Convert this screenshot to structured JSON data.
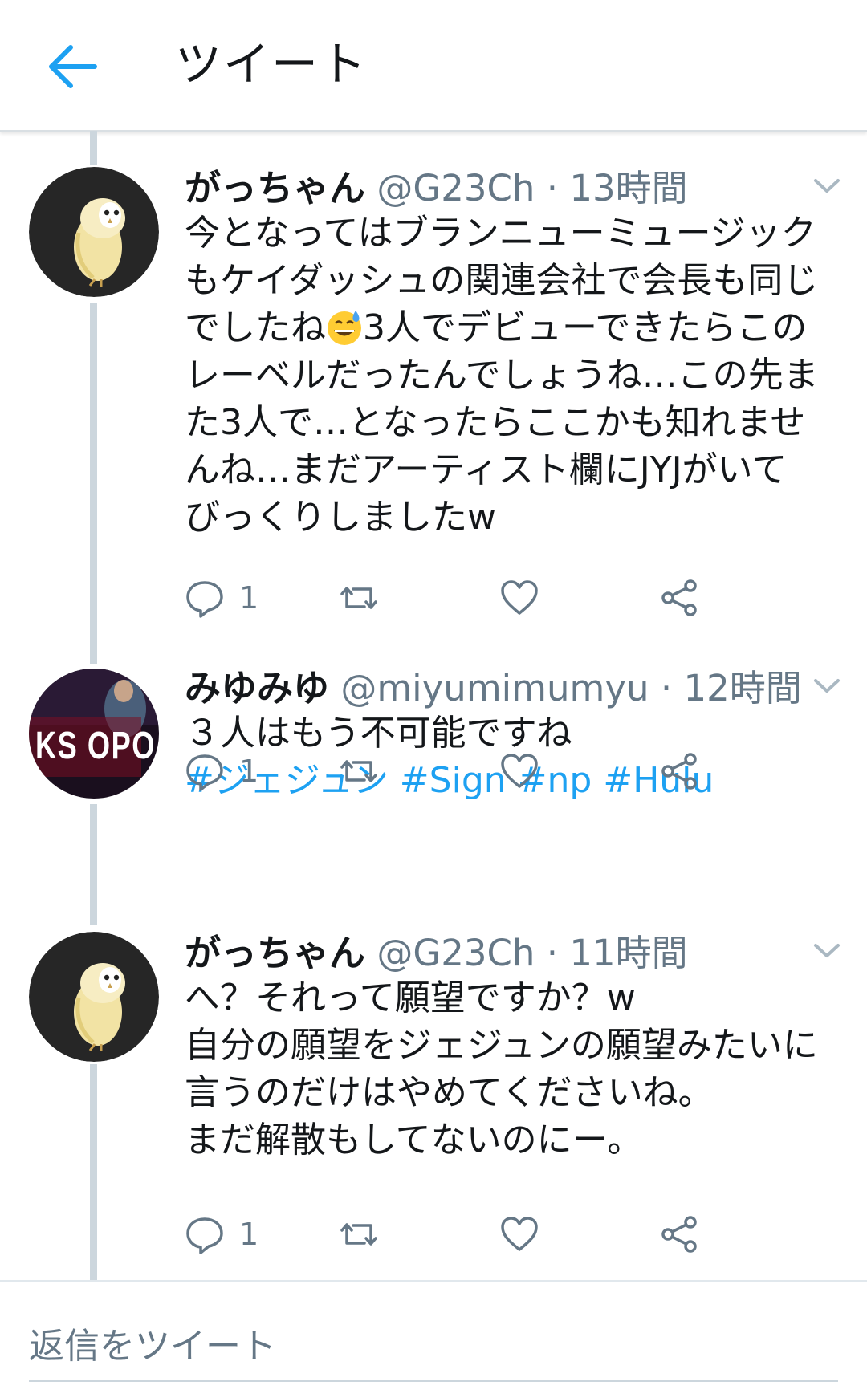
{
  "header": {
    "title": "ツイート",
    "back_icon": "arrow-left-icon",
    "accent": "#1da1f2"
  },
  "tweets": [
    {
      "name": "がっちゃん",
      "handle": "@G23Ch",
      "sep": "·",
      "time": "13時間",
      "lines": [
        "今となってはブランニューミュージック",
        "もケイダッシュの関連会社で会長も同じ",
        {
          "before": "でしたね",
          "emoji": "grinning-sweat-emoji",
          "after": "3人でデビューできたらこの"
        },
        "レーベルだったんでしょうね…この先ま",
        "た3人で…となったらここかも知れませ",
        "んね…まだアーティスト欄にJYJがいて",
        "びっくりしましたw"
      ],
      "reply_count": "1"
    },
    {
      "name": "みゆみゆ",
      "handle": "@miyumimumyu",
      "sep": "·",
      "time": "12時間",
      "lines": [
        "３人はもう不可能ですね"
      ],
      "hashtags": [
        "#ジェジュン",
        "#Sign",
        "#np",
        "#Hulu"
      ],
      "avatar_text": "KS OPO",
      "reply_count": "1"
    },
    {
      "name": "がっちゃん",
      "handle": "@G23Ch",
      "sep": "·",
      "time": "11時間",
      "lines": [
        "へ？それって願望ですか？w",
        "自分の願望をジェジュンの願望みたいに",
        "言うのだけはやめてくださいね。",
        "まだ解散もしてないのにー。"
      ],
      "reply_count": "1"
    }
  ],
  "reply_bar": {
    "placeholder": "返信をツイート"
  }
}
